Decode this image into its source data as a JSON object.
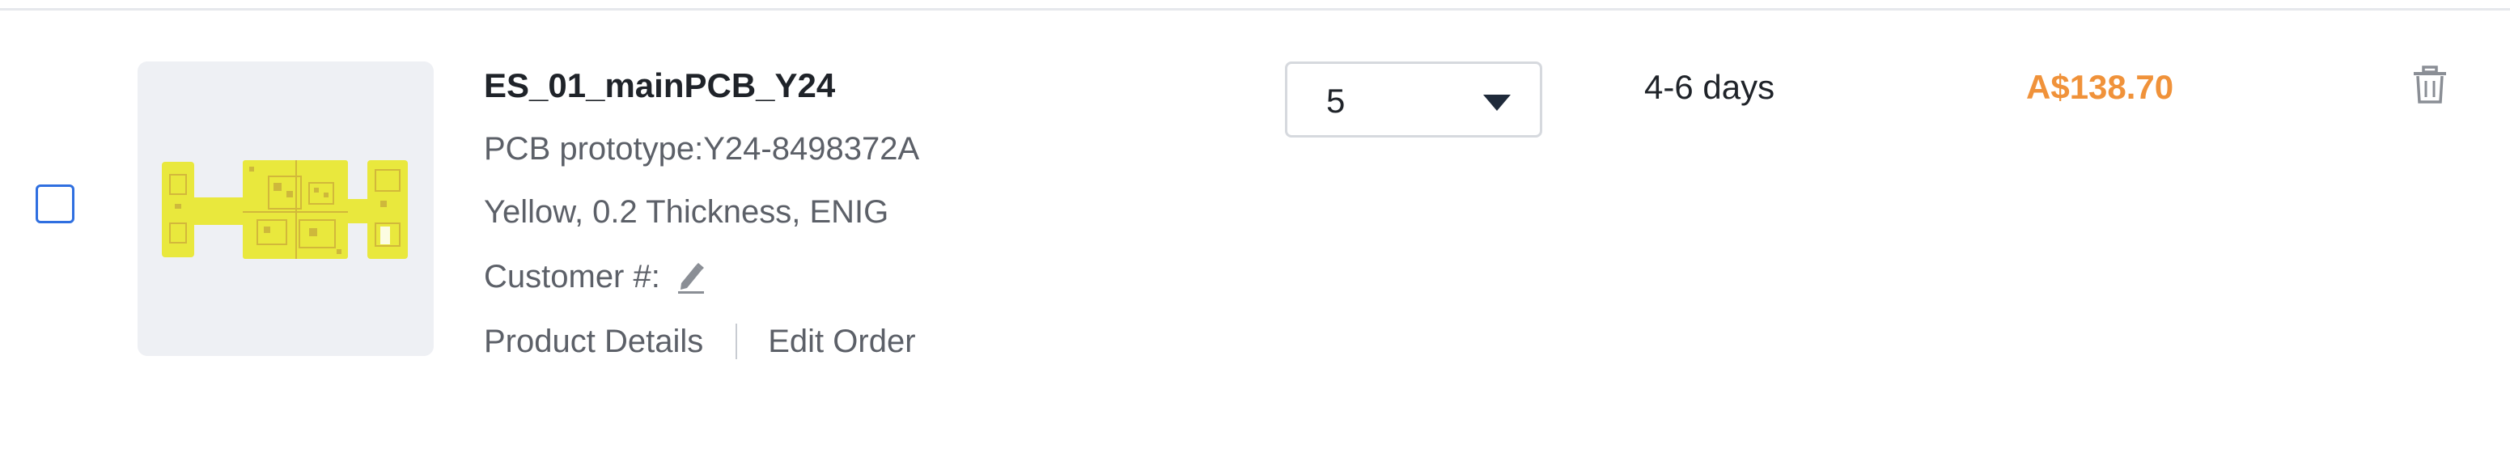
{
  "item": {
    "name": "ES_01_mainPCB_Y24",
    "prototype": "PCB prototype:Y24-8498372A",
    "specs": "Yellow, 0.2 Thickness, ENIG",
    "customer_label": "Customer #:",
    "links": {
      "product_details": "Product Details",
      "edit_order": "Edit Order"
    },
    "quantity": "5",
    "lead_time": "4-6 days",
    "price": "A$138.70",
    "checked": false
  },
  "icons": {
    "edit": "pencil-icon",
    "delete": "trash-icon",
    "dropdown": "chevron-down-icon"
  },
  "colors": {
    "price": "#f0923a",
    "pcb": "#e9e83d",
    "checkbox_border": "#2f6fe0",
    "icon_gray": "#8a8e95"
  }
}
